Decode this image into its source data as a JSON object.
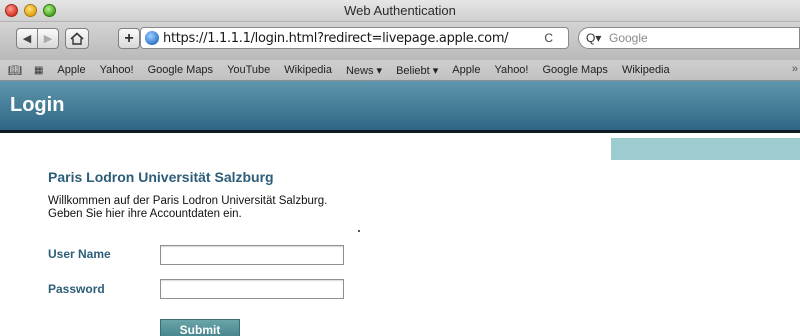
{
  "window": {
    "title": "Web Authentication"
  },
  "toolbar": {
    "url": "https://1.1.1.1/login.html?redirect=livepage.apple.com/",
    "search_placeholder": "Google",
    "reload_glyph": "C"
  },
  "bookmarks": {
    "items": [
      "Apple",
      "Yahoo!",
      "Google Maps",
      "YouTube",
      "Wikipedia",
      "News ▾",
      "Beliebt ▾",
      "Apple",
      "Yahoo!",
      "Google Maps",
      "Wikipedia"
    ],
    "overflow": "»"
  },
  "page": {
    "header_title": "Login",
    "org_title": "Paris Lodron Universität Salzburg",
    "welcome_line1": "Willkommen auf der Paris Lodron Universität Salzburg.",
    "welcome_line2": "Geben Sie hier ihre Accountdaten ein.",
    "user_label": "User Name",
    "password_label": "Password",
    "submit_label": "Submit"
  },
  "colors": {
    "header_top": "#5e97ae",
    "header_bottom": "#2f6585",
    "label_blue": "#2d5d78",
    "accent_strip": "#9ccbd0",
    "submit": "#4f8d93"
  },
  "icons": {
    "back": "back-arrow-icon",
    "forward": "forward-arrow-icon",
    "home": "home-icon",
    "add": "plus-icon",
    "site": "globe-icon",
    "search": "search-icon",
    "bookmarks": "open-book-icon",
    "top_sites": "grid-icon"
  }
}
